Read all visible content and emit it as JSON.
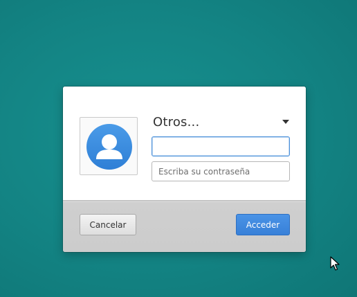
{
  "login": {
    "user_selector_label": "Otros...",
    "username_value": "",
    "password_placeholder": "Escriba su contraseña",
    "cancel_label": "Cancelar",
    "login_label": "Acceder"
  },
  "icons": {
    "avatar": "user-avatar-icon",
    "dropdown": "chevron-down-icon",
    "pointer": "mouse-cursor-icon"
  },
  "colors": {
    "desktop_background": "#138383",
    "accent": "#3d88de",
    "avatar": "#3d8fe0"
  }
}
